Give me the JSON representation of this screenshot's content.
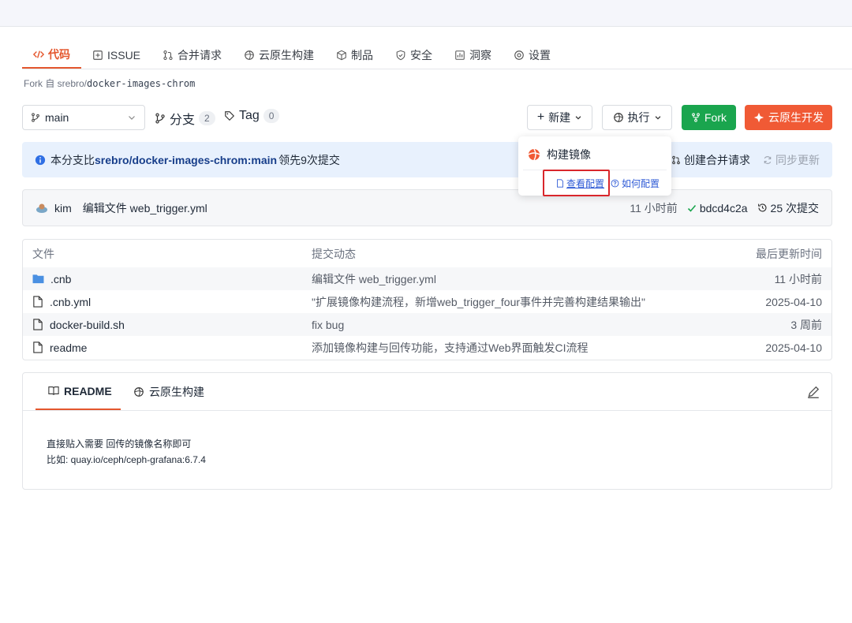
{
  "tabs": [
    {
      "label": "代码",
      "icon": "code-icon"
    },
    {
      "label": "ISSUE",
      "icon": "issue-icon"
    },
    {
      "label": "合并请求",
      "icon": "merge-request-icon"
    },
    {
      "label": "云原生构建",
      "icon": "build-icon"
    },
    {
      "label": "制品",
      "icon": "package-icon"
    },
    {
      "label": "安全",
      "icon": "shield-icon"
    },
    {
      "label": "洞察",
      "icon": "insight-icon"
    },
    {
      "label": "设置",
      "icon": "gear-icon"
    }
  ],
  "fork_info": {
    "prefix": "Fork 自 srebro/",
    "repo": "docker-images-chrom"
  },
  "branch": {
    "value": "main"
  },
  "branches": {
    "label": "分支",
    "count": "2"
  },
  "tags": {
    "label": "Tag",
    "count": "0"
  },
  "actions": {
    "new_label": "新建",
    "run_label": "执行",
    "fork_label": "Fork",
    "cloud_dev_label": "云原生开发"
  },
  "info_bar": {
    "prefix": "本分支比",
    "ref": "srebro/docker-images-chrom:main",
    "suffix": "领先9次提交",
    "create_mr": "创建合并请求",
    "sync": "同步更新"
  },
  "dropdown": {
    "title": "构建镜像",
    "view_config": "查看配置",
    "how_config": "如何配置"
  },
  "last_commit": {
    "author": "kim",
    "message": "编辑文件 web_trigger.yml",
    "time": "11 小时前",
    "hash": "bdcd4c2a",
    "commit_count": "25 次提交"
  },
  "file_table": {
    "headers": {
      "file": "文件",
      "commit": "提交动态",
      "updated": "最后更新时间"
    },
    "rows": [
      {
        "name": ".cnb",
        "type": "folder",
        "commit": "编辑文件 web_trigger.yml",
        "updated": "11 小时前"
      },
      {
        "name": ".cnb.yml",
        "type": "file",
        "commit": "\"扩展镜像构建流程，新增web_trigger_four事件并完善构建结果输出\"",
        "updated": "2025-04-10"
      },
      {
        "name": "docker-build.sh",
        "type": "file",
        "commit": "fix bug",
        "updated": "3 周前"
      },
      {
        "name": "readme",
        "type": "file",
        "commit": "添加镜像构建与回传功能，支持通过Web界面触发CI流程",
        "updated": "2025-04-10"
      }
    ]
  },
  "readme": {
    "tab_readme": "README",
    "tab_build": "云原生构建",
    "line1": "直接贴入需要 回传的镜像名称即可",
    "line2": "比如:   quay.io/ceph/ceph-grafana:6.7.4"
  },
  "colors": {
    "accent": "#e4572e",
    "fork_green": "#1aa54e",
    "cloud_orange": "#f05a35",
    "info_bg": "#e8f1fd",
    "highlight_red": "#d9262b"
  }
}
